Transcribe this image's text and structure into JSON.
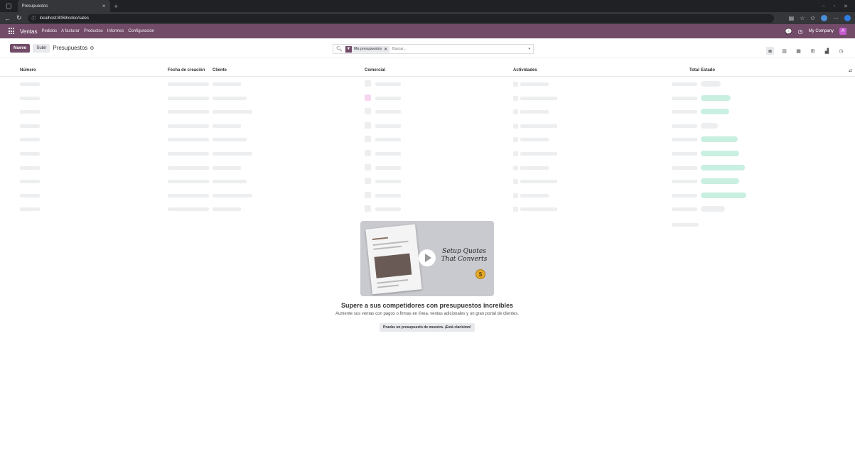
{
  "browser": {
    "tab_title": "Presupuestos",
    "tab_close": "×",
    "new_tab": "+",
    "url": "localhost:8069/odoo/sales"
  },
  "navbar": {
    "app_name": "Ventas",
    "menu": [
      "Pedidos",
      "A facturar",
      "Productos",
      "Informes",
      "Configuración"
    ],
    "company": "My Company",
    "avatar_letter": "A"
  },
  "control_panel": {
    "new_label": "Nuevo",
    "upload_label": "Subir",
    "breadcrumb": "Presupuestos",
    "search": {
      "facet_label": "Mis presupuestos",
      "placeholder": "Buscar..."
    }
  },
  "list": {
    "columns": {
      "number": "Número",
      "creation_date": "Fecha de creación",
      "customer": "Cliente",
      "salesperson": "Comercial",
      "activities": "Actividades",
      "total": "Total",
      "status": "Estado"
    }
  },
  "helper": {
    "video_caption_line1": "Setup Quotes",
    "video_caption_line2": "That Converts",
    "title": "Supere a sus competidores con presupuestos increíbles",
    "description": "Aumente sus ventas con pagos o firmas en línea, ventas adicionales y un gran portal de clientes.",
    "button": "Pruebe un presupuesto de muestra. ¡Está clarísimo!"
  },
  "colors": {
    "brand": "#714B67",
    "badge_green": "#c9efe0",
    "badge_grey": "#eceef0"
  }
}
